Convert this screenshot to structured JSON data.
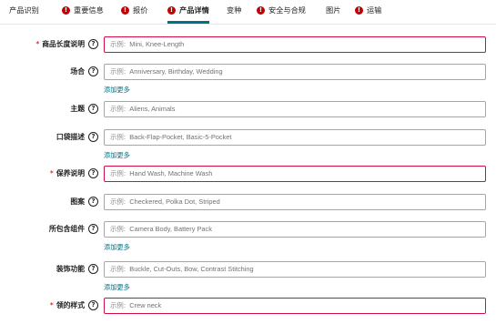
{
  "tabs": [
    {
      "label": "产品识别",
      "error": false,
      "active": false
    },
    {
      "label": "重要信息",
      "error": true,
      "active": false
    },
    {
      "label": "报价",
      "error": true,
      "active": false
    },
    {
      "label": "产品详情",
      "error": true,
      "active": true
    },
    {
      "label": "变种",
      "error": false,
      "active": false
    },
    {
      "label": "安全与合规",
      "error": true,
      "active": false
    },
    {
      "label": "图片",
      "error": false,
      "active": false
    },
    {
      "label": "运输",
      "error": true,
      "active": false
    }
  ],
  "example_prefix": "示例:",
  "help_symbol": "?",
  "error_symbol": "!",
  "required_mark": "*",
  "add_more_label": "添加更多",
  "fields": [
    {
      "label": "商品长度说明",
      "required": true,
      "placeholder": "Mini, Knee-Length",
      "add_more": false
    },
    {
      "label": "场合",
      "required": false,
      "placeholder": "Anniversary, Birthday, Wedding",
      "add_more": true
    },
    {
      "label": "主题",
      "required": false,
      "placeholder": "Aliens, Animals",
      "add_more": false
    },
    {
      "label": "口袋描述",
      "required": false,
      "placeholder": "Back-Flap-Pocket, Basic-5-Pocket",
      "add_more": true
    },
    {
      "label": "保养说明",
      "required": true,
      "placeholder": "Hand Wash, Machine Wash",
      "add_more": false
    },
    {
      "label": "图案",
      "required": false,
      "placeholder": "Checkered, Polka Dot, Striped",
      "add_more": false
    },
    {
      "label": "所包含组件",
      "required": false,
      "placeholder": "Camera Body, Battery Pack",
      "add_more": true
    },
    {
      "label": "装饰功能",
      "required": false,
      "placeholder": "Buckle, Cut-Outs, Bow, Contrast Stitching",
      "add_more": true
    },
    {
      "label": "领的样式",
      "required": true,
      "placeholder": "Crew neck",
      "add_more": false
    }
  ],
  "colors": {
    "accent": "#007185",
    "error": "#c40000",
    "required_border": "#d10f45",
    "input_border": "#a6a6a6"
  }
}
